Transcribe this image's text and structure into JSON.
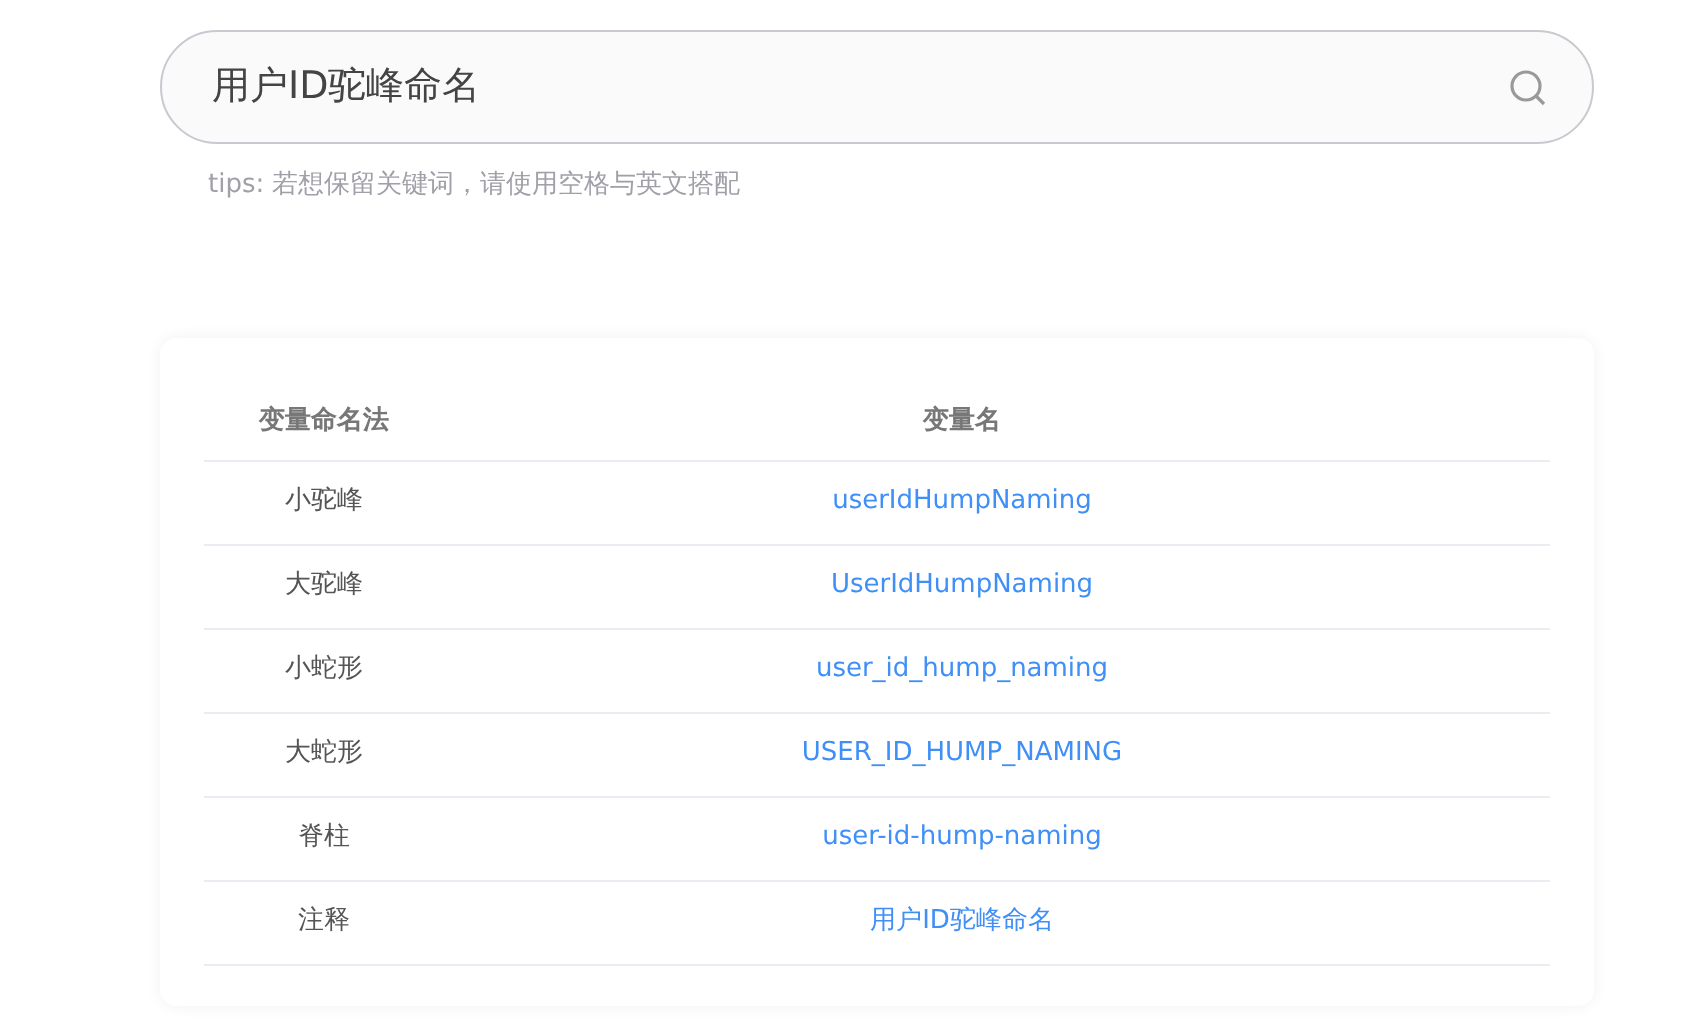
{
  "search": {
    "value": "用户ID驼峰命名"
  },
  "tips": "tips: 若想保留关键词，请使用空格与英文搭配",
  "table": {
    "columns": [
      "变量命名法",
      "变量名"
    ],
    "rows": [
      {
        "style": "小驼峰",
        "name": "userIdHumpNaming"
      },
      {
        "style": "大驼峰",
        "name": "UserIdHumpNaming"
      },
      {
        "style": "小蛇形",
        "name": "user_id_hump_naming"
      },
      {
        "style": "大蛇形",
        "name": "USER_ID_HUMP_NAMING"
      },
      {
        "style": "脊柱",
        "name": "user-id-hump-naming"
      },
      {
        "style": "注释",
        "name": "用户ID驼峰命名"
      }
    ]
  }
}
